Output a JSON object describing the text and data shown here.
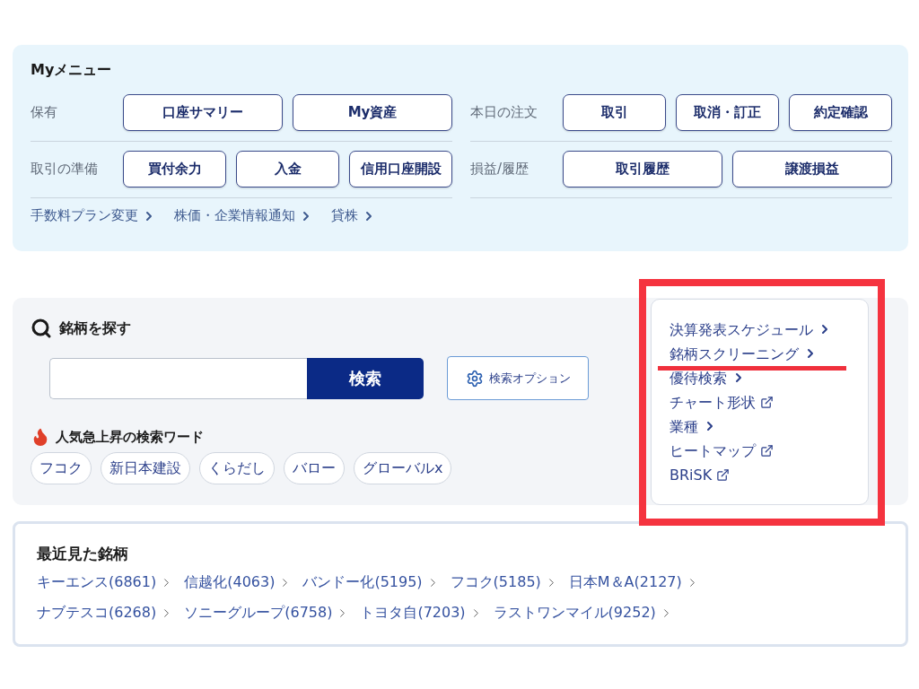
{
  "my_menu": {
    "title": "Myメニュー",
    "columns": [
      [
        {
          "label": "保有",
          "buttons": [
            "口座サマリー",
            "My資産"
          ]
        },
        {
          "label": "取引の準備",
          "buttons": [
            "買付余力",
            "入金",
            "信用口座開設"
          ]
        }
      ],
      [
        {
          "label": "本日の注文",
          "buttons": [
            "取引",
            "取消・訂正",
            "約定確認"
          ]
        },
        {
          "label": "損益/履歴",
          "buttons": [
            "取引履歴",
            "譲渡損益"
          ]
        }
      ]
    ],
    "links": [
      "手数料プラン変更",
      "株価・企業情報通知",
      "貸株"
    ]
  },
  "stock_search": {
    "title": "銘柄を探す",
    "search_button": "検索",
    "options_button": "検索オプション",
    "trending_title": "人気急上昇の検索ワード",
    "trending_words": [
      "フコク",
      "新日本建設",
      "くらだし",
      "バロー",
      "グローバルx"
    ]
  },
  "side_links": [
    {
      "label": "決算発表スケジュール",
      "kind": "arrow",
      "marked": false
    },
    {
      "label": "銘柄スクリーニング",
      "kind": "arrow",
      "marked": true
    },
    {
      "label": "優待検索",
      "kind": "arrow",
      "marked": false
    },
    {
      "label": "チャート形状",
      "kind": "external",
      "marked": false
    },
    {
      "label": "業種",
      "kind": "arrow",
      "marked": false
    },
    {
      "label": "ヒートマップ",
      "kind": "external",
      "marked": false
    },
    {
      "label": "BRiSK",
      "kind": "external",
      "marked": false
    }
  ],
  "recent": {
    "title": "最近見た銘柄",
    "rows": [
      [
        "キーエンス(6861)",
        "信越化(4063)",
        "バンドー化(5195)",
        "フコク(5185)",
        "日本M＆A(2127)"
      ],
      [
        "ナブテスコ(6268)",
        "ソニーグループ(6758)",
        "トヨタ自(7203)",
        "ラストワンマイル(9252)"
      ]
    ]
  }
}
